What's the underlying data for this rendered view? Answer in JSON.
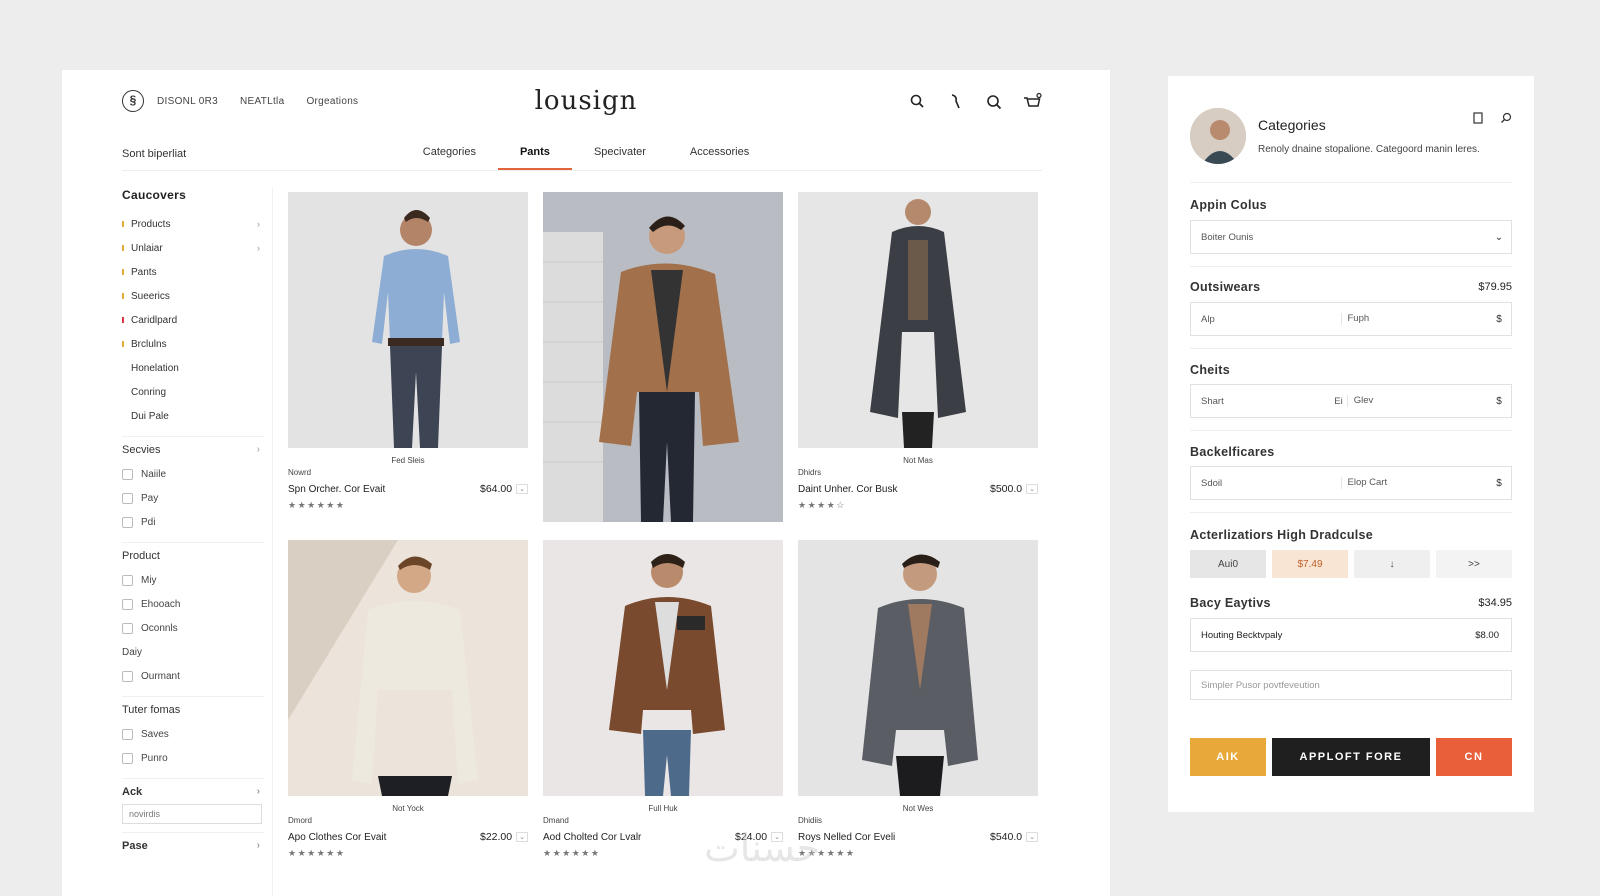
{
  "colors": {
    "accent": "#e2643b",
    "yellow": "#e8a93a",
    "dark": "#1f1f1f",
    "orange": "#e85f3a",
    "peach": "#f8e5d4",
    "gray_seg": "#e6e6e6"
  },
  "header": {
    "logo_icon": "circle-logo-icon",
    "nav": [
      "DISONL 0R3",
      "NEATLtla",
      "Orgeations"
    ],
    "brand": "lousign",
    "icons": [
      "search-icon",
      "hook-icon",
      "search-icon",
      "cart-icon"
    ]
  },
  "sort_label": "Sont biperliat",
  "tabs": [
    {
      "label": "Categories",
      "active": false
    },
    {
      "label": "Pants",
      "active": true
    },
    {
      "label": "Specivater",
      "active": false
    },
    {
      "label": "Accessories",
      "active": false
    }
  ],
  "sidebar": {
    "title": "Caucovers",
    "items": [
      {
        "label": "Products",
        "dot": "#e8a93a",
        "arrow": "›"
      },
      {
        "label": "Unlaiar",
        "dot": "#e8a93a",
        "arrow": "›"
      },
      {
        "label": "Pants",
        "dot": "#e8a93a",
        "arrow": ""
      },
      {
        "label": "Sueerics",
        "dot": "#e8a93a",
        "arrow": ""
      },
      {
        "label": "Caridlpard",
        "dot": "#d9364a",
        "arrow": ""
      },
      {
        "label": "Brclulns",
        "dot": "#e8a93a",
        "arrow": ""
      }
    ],
    "plain_items": [
      "Honelation",
      "Conring",
      "Dui Pale"
    ],
    "section_services": "Secvies",
    "services_checks": [
      "Naiile",
      "Pay",
      "Pdi"
    ],
    "section_product": "Product",
    "product_checks": [
      "Miy",
      "Ehooach",
      "Oconnls"
    ],
    "product_plain": "Daiy",
    "product_check_last": "Ourmant",
    "section_other": "Tuter fomas",
    "other_checks": [
      "Saves",
      "Punro"
    ],
    "section_ack": "Ack",
    "ack_input": "novirdis",
    "section_pase": "Pase"
  },
  "products": [
    {
      "caption": "Fed Sleis",
      "brand": "Nowrd",
      "name": "Spn Orcher. Cor Evait",
      "price": "$64.00",
      "stars": "★★★★★★",
      "tall": false
    },
    {
      "caption": "",
      "brand": "",
      "name": "",
      "price": "",
      "stars": "",
      "tall": true
    },
    {
      "caption": "Not Mas",
      "brand": "Dhidrs",
      "name": "Daint Unher. Cor Busk",
      "price": "$500.0",
      "stars": "★★★★☆",
      "tall": false
    },
    {
      "caption": "Not Yock",
      "brand": "Dmord",
      "name": "Apo Clothes Cor Evait",
      "price": "$22.00",
      "stars": "★★★★★★",
      "tall": false
    },
    {
      "caption": "Full Huk",
      "brand": "Dmand",
      "name": "Aod Cholted Cor Lvalr",
      "price": "$24.00",
      "stars": "★★★★★★",
      "tall": false
    },
    {
      "caption": "Not Wes",
      "brand": "Dhidiis",
      "name": "Roys Nelled Cor Eveli",
      "price": "$540.0",
      "stars": "★★★★★★",
      "tall": false
    }
  ],
  "panel": {
    "title": "Categories",
    "subtitle": "Renoly dnaine stopalione. Categoord manin leres.",
    "icons": [
      "note-icon",
      "search-icon"
    ],
    "s1_label": "Appin Colus",
    "s1_select": "Boiter Ounis",
    "s2_label": "Outsiwears",
    "s2_value": "$79.95",
    "s2_f1": "Alp",
    "s2_f2": "Fuph",
    "s2_f3": "$",
    "s3_label": "Cheits",
    "s3_f1": "Shart",
    "s3_mid": "Ei",
    "s3_f2": "Glev",
    "s3_f3": "$",
    "s4_label": "Backelficares",
    "s4_f1": "Sdoil",
    "s4_f2": "Elop Cart",
    "s4_f3": "$",
    "s5_label": "Acterlizatiors High Dradculse",
    "seg": [
      "Aui0",
      "$7.49",
      "↓",
      ">>"
    ],
    "s6_label": "Bacy Eaytivs",
    "s6_value": "$34.95",
    "s6_field": "Houting Becktvpaly",
    "s6_field_value": "$8.00",
    "textarea_placeholder": "Simpler Pusor povtfeveution",
    "btn1": "AIK",
    "btn2": "APPLOFT FORE",
    "btn3": "CN"
  },
  "watermark": "حسنات"
}
